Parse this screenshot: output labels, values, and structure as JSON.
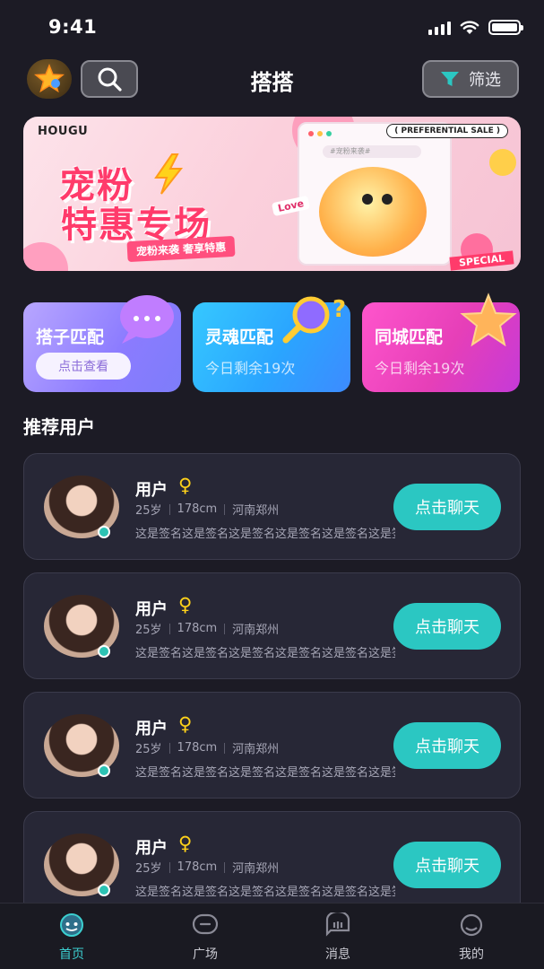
{
  "status_bar": {
    "time": "9:41"
  },
  "header": {
    "title": "搭搭",
    "filter_label": "筛选"
  },
  "banner": {
    "brand": "HOUGU",
    "title_line1": "宠粉",
    "title_line2": "特惠专场",
    "subtitle": "宠粉来袭 奢享特惠",
    "preferential": "( PREFERENTIAL SALE )",
    "search_text": "#宠粉来袭#",
    "love_tag": "Love",
    "special": "SPECIAL"
  },
  "match_cards": [
    {
      "label": "搭子匹配",
      "button": "点击查看"
    },
    {
      "label": "灵魂匹配",
      "sub": "今日剩余19次"
    },
    {
      "label": "同城匹配",
      "sub": "今日剩余19次"
    }
  ],
  "section_title": "推荐用户",
  "users": [
    {
      "name": "用户",
      "gender": "♀",
      "age": "25岁",
      "height": "178cm",
      "city": "河南郑州",
      "signature": "这是签名这是签名这是签名这是签名这是签名这是签名",
      "button": "点击聊天"
    },
    {
      "name": "用户",
      "gender": "♀",
      "age": "25岁",
      "height": "178cm",
      "city": "河南郑州",
      "signature": "这是签名这是签名这是签名这是签名这是签名这是签名",
      "button": "点击聊天"
    },
    {
      "name": "用户",
      "gender": "♀",
      "age": "25岁",
      "height": "178cm",
      "city": "河南郑州",
      "signature": "这是签名这是签名这是签名这是签名这是签名这是签名",
      "button": "点击聊天"
    },
    {
      "name": "用户",
      "gender": "♀",
      "age": "25岁",
      "height": "178cm",
      "city": "河南郑州",
      "signature": "这是签名这是签名这是签名这是签名这是签名这是签名",
      "button": "点击聊天"
    }
  ],
  "tabs": [
    {
      "label": "首页",
      "icon": "home-face-icon",
      "active": true
    },
    {
      "label": "广场",
      "icon": "square-chat-icon",
      "active": false
    },
    {
      "label": "消息",
      "icon": "message-icon",
      "active": false
    },
    {
      "label": "我的",
      "icon": "profile-icon",
      "active": false
    }
  ],
  "colors": {
    "background": "#1c1b25",
    "accent": "#2bc7c2",
    "card": "#272736",
    "gender": "#ffd21a"
  }
}
